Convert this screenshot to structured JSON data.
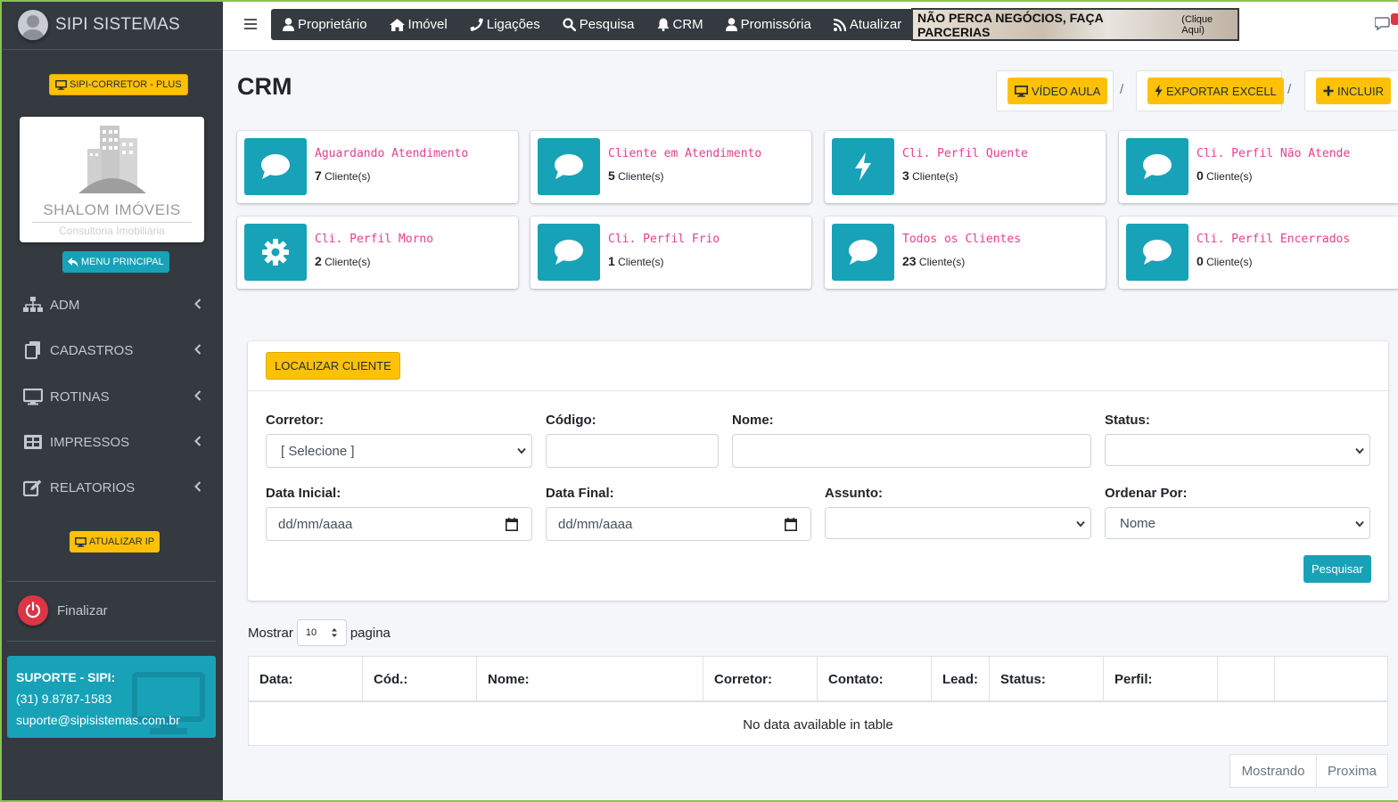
{
  "sidebar": {
    "brand": "SIPI SISTEMAS",
    "plan_badge": "SIPI-CORRETOR - PLUS",
    "logo": {
      "name": "SHALOM IMÓVEIS",
      "subtitle": "Consultoria Imobiliária"
    },
    "menu_principal": "MENU PRINCIPAL",
    "items": [
      {
        "label": "ADM",
        "icon": "sitemap-icon"
      },
      {
        "label": "CADASTROS",
        "icon": "copy-icon"
      },
      {
        "label": "ROTINAS",
        "icon": "desktop-icon"
      },
      {
        "label": "IMPRESSOS",
        "icon": "grid-icon"
      },
      {
        "label": "RELATORIOS",
        "icon": "edit-icon"
      }
    ],
    "atualizar_ip": "ATUALIZAR IP",
    "finalizar": "Finalizar",
    "support": {
      "title": "SUPORTE - SIPI:",
      "phone": "(31) 9.8787-1583",
      "email": "suporte@sipisistemas.com.br"
    }
  },
  "topnav": {
    "links": [
      {
        "label": "Proprietário",
        "icon": "user-icon"
      },
      {
        "label": "Imóvel",
        "icon": "home-icon"
      },
      {
        "label": "Ligações",
        "icon": "phone-icon"
      },
      {
        "label": "Pesquisa",
        "icon": "search-icon"
      },
      {
        "label": "CRM",
        "icon": "bell-icon"
      },
      {
        "label": "Promissória",
        "icon": "user-icon"
      },
      {
        "label": "Atualizar",
        "icon": "rss-icon"
      }
    ],
    "banner": {
      "text": "NÃO PERCA NEGÓCIOS, FAÇA PARCERIAS",
      "link": "(Clique Aqui)"
    }
  },
  "page": {
    "title": "CRM",
    "actions": {
      "video": "VÍDEO AULA",
      "export": "EXPORTAR EXCELL",
      "include": "INCLUIR",
      "separator": "/"
    }
  },
  "info_boxes": [
    {
      "title": "Aguardando Atendimento",
      "count": "7",
      "unit": "Cliente(s)",
      "icon": "comment-icon"
    },
    {
      "title": "Cliente em Atendimento",
      "count": "5",
      "unit": "Cliente(s)",
      "icon": "comment-icon"
    },
    {
      "title": "Cli. Perfil Quente",
      "count": "3",
      "unit": "Cliente(s)",
      "icon": "bolt-icon"
    },
    {
      "title": "Cli. Perfil Não Atende",
      "count": "0",
      "unit": "Cliente(s)",
      "icon": "comment-icon"
    },
    {
      "title": "Cli. Perfil Morno",
      "count": "2",
      "unit": "Cliente(s)",
      "icon": "gear-icon"
    },
    {
      "title": "Cli. Perfil Frio",
      "count": "1",
      "unit": "Cliente(s)",
      "icon": "comment-icon"
    },
    {
      "title": "Todos os Clientes",
      "count": "23",
      "unit": "Cliente(s)",
      "icon": "comment-icon"
    },
    {
      "title": "Cli. Perfil Encerrados",
      "count": "0",
      "unit": "Cliente(s)",
      "icon": "comment-icon"
    }
  ],
  "search": {
    "header_button": "LOCALIZAR CLIENTE",
    "labels": {
      "corretor": "Corretor:",
      "codigo": "Código:",
      "nome": "Nome:",
      "status": "Status:",
      "data_inicial": "Data Inicial:",
      "data_final": "Data Final:",
      "assunto": "Assunto:",
      "ordenar": "Ordenar Por:"
    },
    "values": {
      "corretor": "[ Selecione ]",
      "codigo": "",
      "nome": "",
      "status": "",
      "data_inicial": "dd/mm/aaaa",
      "data_final": "dd/mm/aaaa",
      "assunto": "",
      "ordenar": "Nome"
    },
    "submit": "Pesquisar"
  },
  "table": {
    "length_prefix": "Mostrar",
    "length_value": "10",
    "length_suffix": "pagina",
    "columns": [
      "Data:",
      "Cód.:",
      "Nome:",
      "Corretor:",
      "Contato:",
      "Lead:",
      "Status:",
      "Perfil:",
      "",
      ""
    ],
    "empty": "No data available in table",
    "pager": {
      "info": "Mostrando",
      "next": "Proxima"
    }
  },
  "colors": {
    "accent": "#17a2b8",
    "warning": "#ffc107",
    "sidebar": "#343a40",
    "danger": "#dc3545",
    "pink": "#e83e8c"
  }
}
